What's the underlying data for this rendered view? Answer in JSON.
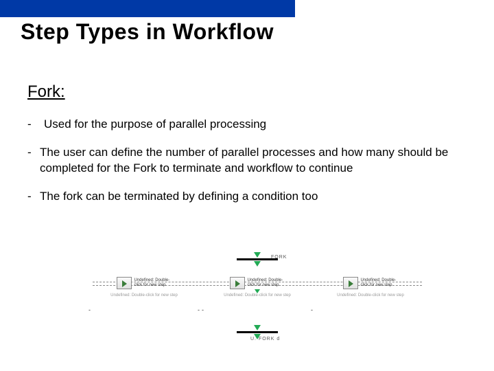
{
  "title": "Step Types in Workflow",
  "section": "Fork:",
  "bullets": [
    "Used for the purpose of parallel processing",
    "The user can define the number of parallel processes and how many should be completed for the Fork to terminate and workflow to continue",
    "The fork can be terminated by defining a condition too"
  ],
  "diagram": {
    "fork_label": "FORK",
    "join_label": "U. FORK d",
    "node_text": "Undefined: Double-click for new step",
    "under_text": "Undefined: Double-click for new step"
  }
}
